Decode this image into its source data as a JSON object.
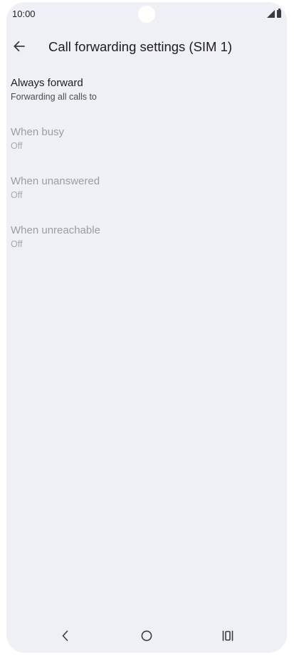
{
  "status_bar": {
    "time": "10:00"
  },
  "app_bar": {
    "title": "Call forwarding settings (SIM 1)"
  },
  "settings": [
    {
      "title": "Always forward",
      "subtitle": "Forwarding all calls to",
      "enabled": true
    },
    {
      "title": "When busy",
      "subtitle": "Off",
      "enabled": false
    },
    {
      "title": "When unanswered",
      "subtitle": "Off",
      "enabled": false
    },
    {
      "title": "When unreachable",
      "subtitle": "Off",
      "enabled": false
    }
  ],
  "colors": {
    "screen_background": "#eff0f6",
    "primary_text": "#1d1d22",
    "disabled_text": "#9c9da3",
    "icon": "#3a3b40"
  },
  "icons": {
    "back": "arrow-left-icon",
    "signal": "cell-signal-icon",
    "battery": "battery-icon",
    "nav_back": "chevron-left-icon",
    "nav_home": "circle-home-icon",
    "nav_recents": "recents-bars-icon"
  }
}
